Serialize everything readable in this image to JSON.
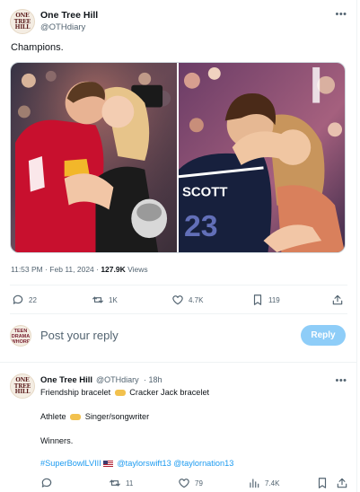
{
  "tweet": {
    "author": {
      "name": "One Tree Hill",
      "handle": "@OTHdiary",
      "avatar_text": "ONE TREE HILL"
    },
    "text": "Champions.",
    "timestamp": "11:53 PM · Feb 11, 2024 · ",
    "views_count": "127.9K",
    "views_label": " Views",
    "actions": {
      "replies": "22",
      "retweets": "1K",
      "likes": "4.7K",
      "bookmarks": "119"
    },
    "photos": [
      {
        "jersey_text": "",
        "colors": [
          "#c8102e",
          "#f6c0a3",
          "#0b1e3a"
        ]
      },
      {
        "jersey_text": "SCOTT",
        "colors": [
          "#17203d",
          "#f1c79e",
          "#6b3a1d"
        ]
      }
    ]
  },
  "composer": {
    "avatar_text": "TEEN DRAMA WHORE",
    "placeholder": "Post your reply",
    "button_label": "Reply"
  },
  "reply": {
    "author": {
      "name": "One Tree Hill",
      "handle": "@OTHdiary",
      "time": "· 18h"
    },
    "lines": [
      {
        "before": "Friendship bracelet",
        "after": "Cracker Jack bracelet"
      },
      {
        "before": "Athlete",
        "after": "Singer/songwriter"
      },
      {
        "before": "Winners.",
        "after": ""
      }
    ],
    "hashtag": "#SuperBowlLVIII",
    "mentions": [
      "@taylorswift13",
      "@taylornation13"
    ],
    "actions": {
      "replies": "",
      "retweets": "11",
      "likes": "79",
      "views": "7.4K",
      "bookmarks": ""
    }
  },
  "colors": {
    "accent": "#1d9bf0",
    "muted": "#536471",
    "reply_button": "#8ecdf8"
  }
}
